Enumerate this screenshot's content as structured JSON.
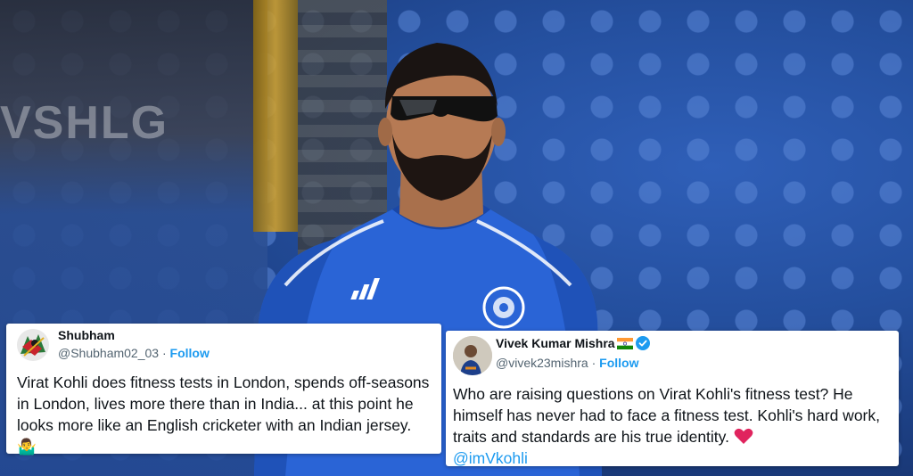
{
  "tweets": [
    {
      "name": "Shubham",
      "handle": "@Shubham02_03",
      "separator": " · ",
      "follow_label": "Follow",
      "avatar_icon": "abstract-art-avatar",
      "text": "Virat Kohli does fitness tests in London, spends off-seasons in London, lives more there than in India... at this point he looks more like an English cricketer with an Indian jersey.",
      "emoji": "🤷‍♂️"
    },
    {
      "name": "Vivek Kumar Mishra",
      "handle": "@vivek23mishra",
      "separator": " · ",
      "follow_label": "Follow",
      "avatar_icon": "person-photo-avatar",
      "flag_icon": "india-flag-icon",
      "verified_icon": "verified-badge-icon",
      "text": "Who are raising questions on Virat Kohli's fitness test? He himself has never had to face a fitness test. Kohli's hard work, traits and standards are his true identity.",
      "emoji": "❤️",
      "mention": "@imVkohli"
    }
  ],
  "background": {
    "signboard_text": "VSHLG",
    "jersey_color": "#2a64d6",
    "stadium_seat_color": "#4a78c8"
  },
  "colors": {
    "link": "#1d9bf0",
    "text": "#0f1419",
    "muted": "#536471"
  }
}
